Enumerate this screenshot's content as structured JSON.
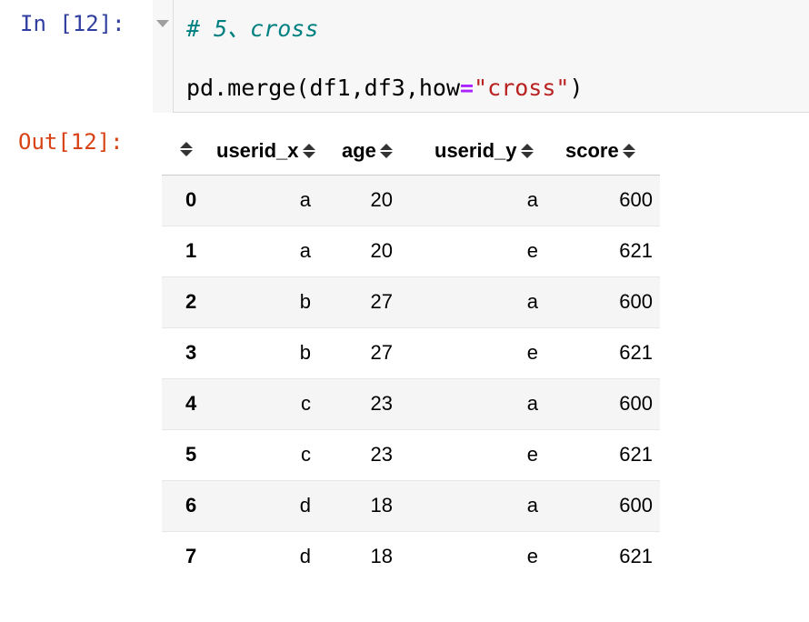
{
  "input_cell": {
    "prompt": "In [12]:",
    "code": {
      "comment": "# 5、cross",
      "call_prefix": "pd.merge(df1,df3,how",
      "operator": "=",
      "string_arg": "\"cross\"",
      "call_suffix": ")"
    }
  },
  "output_cell": {
    "prompt": "Out[12]:",
    "dataframe": {
      "columns": [
        "userid_x",
        "age",
        "userid_y",
        "score"
      ],
      "rows": [
        {
          "index": "0",
          "userid_x": "a",
          "age": "20",
          "userid_y": "a",
          "score": "600"
        },
        {
          "index": "1",
          "userid_x": "a",
          "age": "20",
          "userid_y": "e",
          "score": "621"
        },
        {
          "index": "2",
          "userid_x": "b",
          "age": "27",
          "userid_y": "a",
          "score": "600"
        },
        {
          "index": "3",
          "userid_x": "b",
          "age": "27",
          "userid_y": "e",
          "score": "621"
        },
        {
          "index": "4",
          "userid_x": "c",
          "age": "23",
          "userid_y": "a",
          "score": "600"
        },
        {
          "index": "5",
          "userid_x": "c",
          "age": "23",
          "userid_y": "e",
          "score": "621"
        },
        {
          "index": "6",
          "userid_x": "d",
          "age": "18",
          "userid_y": "a",
          "score": "600"
        },
        {
          "index": "7",
          "userid_x": "d",
          "age": "18",
          "userid_y": "e",
          "score": "621"
        }
      ]
    }
  },
  "colors": {
    "in_prompt": "#303f9f",
    "out_prompt": "#d84315",
    "comment": "#008080",
    "operator": "#aa22ff",
    "string": "#ba2121",
    "editor_bg": "#f7f7f7",
    "striped_row": "#f5f5f5"
  },
  "icons": {
    "collapse": "chevron-down-icon",
    "sort": "sort-icon"
  }
}
